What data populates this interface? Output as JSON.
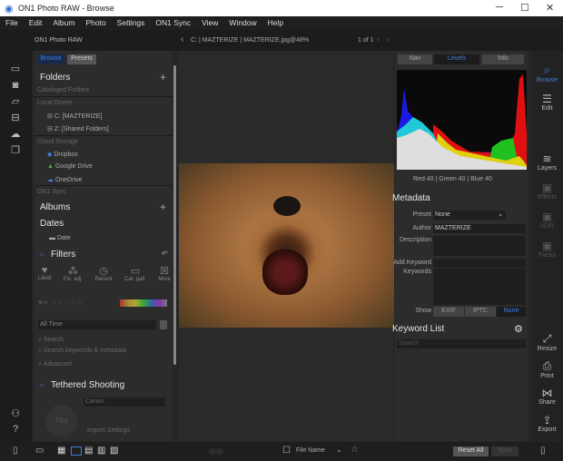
{
  "window": {
    "title": "ON1 Photo RAW - Browse",
    "minimize": "─",
    "maximize": "☐",
    "close": "✕"
  },
  "menu": [
    "File",
    "Edit",
    "Album",
    "Photo",
    "Settings",
    "ON1 Sync",
    "View",
    "Window",
    "Help"
  ],
  "app": {
    "name": "ON1 Photo RAW",
    "breadcrumb": "C: | MAZTERIZE | MAZTERIZE.jpg@48%",
    "page_counter": "1 of 1"
  },
  "left_tabs": {
    "browse": "Browse",
    "presets": "Presets"
  },
  "folders": {
    "title": "Folders",
    "cataloged": "Cataloged Folders",
    "local_drives": "Local Drives",
    "drives": [
      "C: [MAZTERIZE]",
      "Z: [Shared Folders]"
    ],
    "cloud_storage": "Cloud Storage",
    "cloud": [
      "Dropbox",
      "Google Drive",
      "OneDrive"
    ],
    "sync": "ON1 Sync"
  },
  "albums": {
    "title": "Albums"
  },
  "dates": {
    "title": "Dates",
    "item": "Date"
  },
  "filters": {
    "title": "Filters",
    "buttons": [
      "Liked",
      "Fix. adj.",
      "Recent",
      "Cat. gall.",
      "More"
    ],
    "time": "All Time",
    "search": "Search",
    "extra1": "Search keywords & metadata",
    "extra2": "Advanced"
  },
  "tethered": {
    "title": "Tethered Shooting",
    "field": "Canon",
    "thumb": "Tmt",
    "link": "Import Settings"
  },
  "right_tabs": {
    "nav": "Nav",
    "levels": "Levels",
    "info": "Info"
  },
  "histogram": {
    "readout": "Red  40  | Green  40  | Blue  40"
  },
  "metadata": {
    "title": "Metadata",
    "preset_label": "Preset",
    "preset_value": "None",
    "author_label": "Author",
    "author_value": "MAZTERIZE",
    "description_label": "Description",
    "add_keyword_label": "Add Keyword",
    "keywords_label": "Keywords",
    "show_label": "Show",
    "show_tabs": [
      "EXIF",
      "IPTC",
      "None"
    ]
  },
  "keyword_list": {
    "title": "Keyword List",
    "search_placeholder": "Search"
  },
  "right_strip": [
    "Browse",
    "Edit",
    "Layers",
    "Effects",
    "HDR",
    "Focus",
    "Resize",
    "Print",
    "Share",
    "Export"
  ],
  "bottom": {
    "sort": "File Name",
    "reset": "Reset All",
    "sync": "Sync"
  },
  "colors": {
    "accent": "#2f6fd6",
    "bg": "#262626",
    "panel": "#2c2c2c"
  }
}
